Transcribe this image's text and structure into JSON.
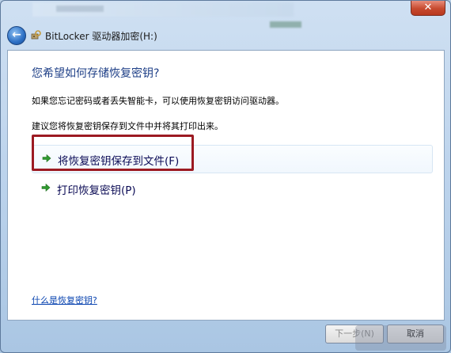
{
  "window": {
    "title": "BitLocker 驱动器加密(H:)",
    "close_label": "✕"
  },
  "content": {
    "heading": "您希望如何存储恢复密钥?",
    "description_1": "如果您忘记密码或者丢失智能卡，可以使用恢复密钥访问驱动器。",
    "description_2": "建议您将恢复密钥保存到文件中并将其打印出来。",
    "options": [
      {
        "label": "将恢复密钥保存到文件(F)",
        "icon": "green-arrow-icon"
      },
      {
        "label": "打印恢复密钥(P)",
        "icon": "green-arrow-icon"
      }
    ],
    "help_link": "什么是恢复密钥?"
  },
  "footer": {
    "next_label": "下一步(N)",
    "cancel_label": "取消"
  },
  "colors": {
    "heading": "#1e3f87",
    "highlight_border": "#9c1a22",
    "arrow": "#2f9a2f",
    "link": "#0a44b0"
  }
}
